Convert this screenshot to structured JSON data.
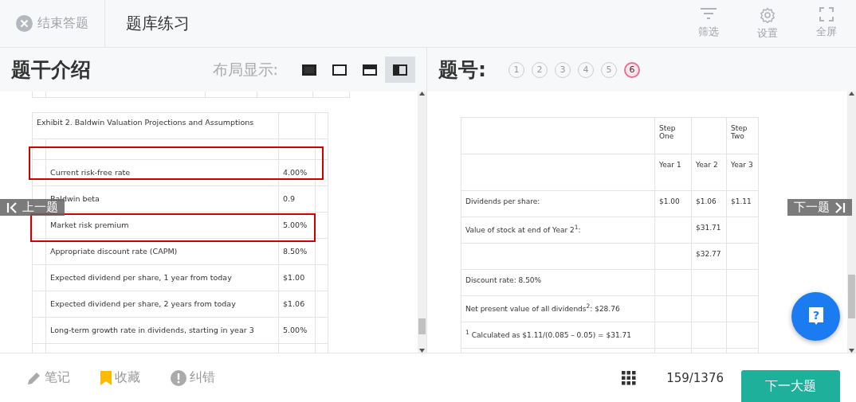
{
  "header": {
    "end_button": "结束答题",
    "title": "题库练习",
    "tools": [
      {
        "kind": "filter",
        "label": "筛选"
      },
      {
        "kind": "settings",
        "label": "设置"
      },
      {
        "kind": "fullscreen",
        "label": "全屏"
      }
    ]
  },
  "left_panel": {
    "title": "题干介绍",
    "layout_label": "布局显示:",
    "layouts": [
      {
        "kind": "filled",
        "selected": false
      },
      {
        "kind": "empty",
        "selected": false
      },
      {
        "kind": "top",
        "selected": false
      },
      {
        "kind": "left",
        "selected": true
      }
    ],
    "exhibit": {
      "title": "Exhibit 2.  Baldwin Valuation Projections and Assumptions",
      "rows": [
        {
          "label": "Current risk-free rate",
          "value": "4.00%",
          "highlighted": true
        },
        {
          "label": "Baldwin beta",
          "value": "0.9",
          "highlighted": false
        },
        {
          "label": "Market risk premium",
          "value": "5.00%",
          "highlighted": true
        },
        {
          "label": "Appropriate discount rate (CAPM)",
          "value": "8.50%",
          "highlighted": false
        },
        {
          "label": "Expected dividend per share, 1 year from today",
          "value": "$1.00",
          "highlighted": false
        },
        {
          "label": "Expected dividend per share, 2 years from today",
          "value": "$1.06",
          "highlighted": false
        },
        {
          "label": "Long-term growth rate in dividends, starting in year 3",
          "value": "5.00%",
          "highlighted": false
        }
      ]
    }
  },
  "prev_button": "上一题",
  "right_panel": {
    "title": "题号:",
    "questions": [
      {
        "label": "1",
        "selected": false
      },
      {
        "label": "2",
        "selected": false
      },
      {
        "label": "3",
        "selected": false
      },
      {
        "label": "4",
        "selected": false
      },
      {
        "label": "5",
        "selected": false
      },
      {
        "label": "6",
        "selected": true
      }
    ],
    "table": {
      "rows": [
        [
          "",
          "Step One",
          "",
          "Step Two"
        ],
        [
          "",
          "Year 1",
          "Year 2",
          "Year 3"
        ],
        [
          "Dividends per share:",
          "$1.00",
          "$1.06",
          "$1.11"
        ],
        [
          "Value of stock at end of Year 2$^{1}$:",
          "",
          "$31.71",
          ""
        ],
        [
          "",
          "",
          "$32.77",
          ""
        ],
        [
          "Discount rate: 8.50%",
          "",
          "",
          ""
        ],
        [
          "Net present value of all dividends$^{2}$: $28.76",
          "",
          "",
          ""
        ],
        [
          "$^{1}$ Calculated as $1.11/(0.085 – 0.05) = $31.71",
          "",
          "",
          ""
        ]
      ]
    }
  },
  "next_button": "下一题",
  "help_button": "?",
  "footer": {
    "actions": [
      {
        "kind": "note",
        "label": "笔记"
      },
      {
        "kind": "bookmark",
        "label": "收藏"
      },
      {
        "kind": "report",
        "label": "纠错"
      }
    ],
    "progress": "159/1376",
    "next_section_button": "下一大题"
  }
}
